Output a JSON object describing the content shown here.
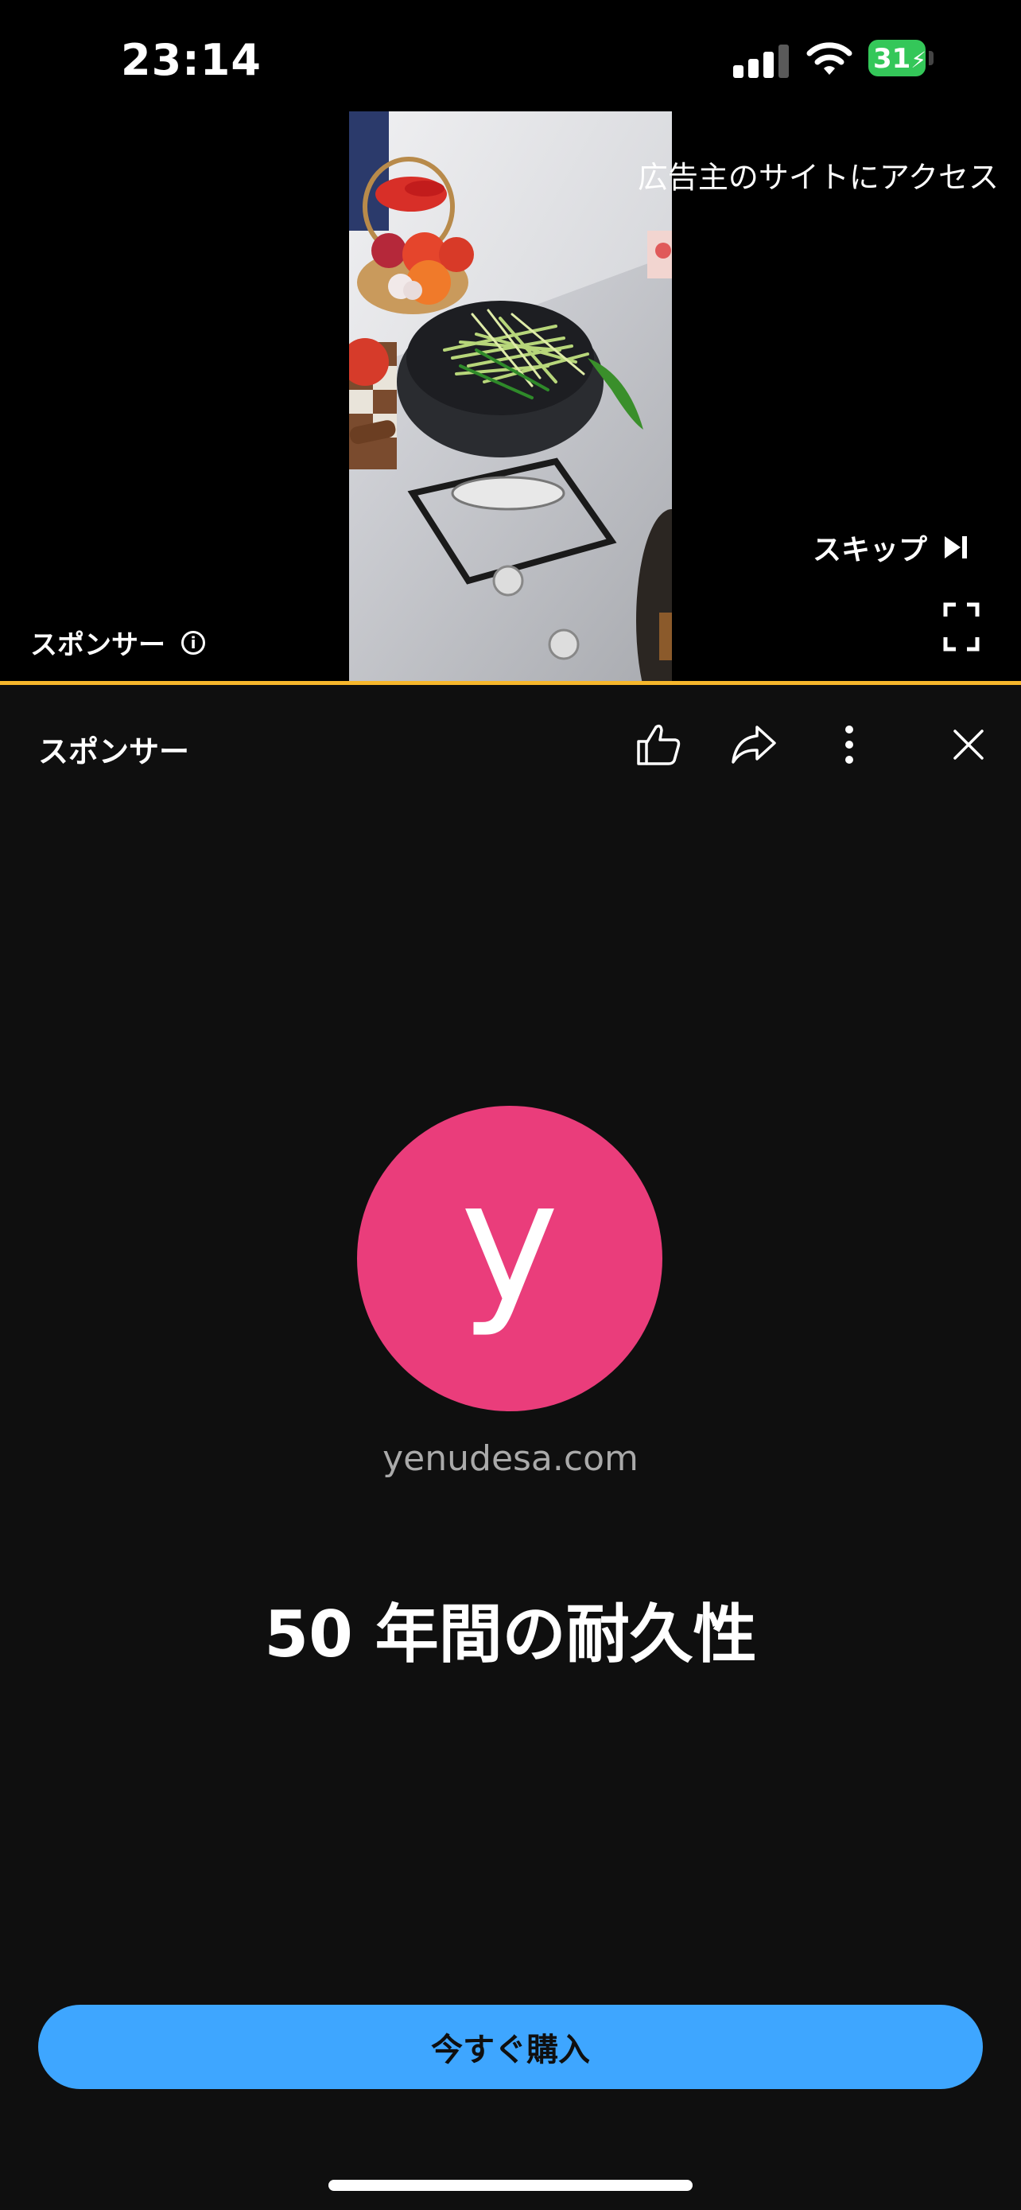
{
  "status_bar": {
    "time": "23:14",
    "battery": "31"
  },
  "player": {
    "visit_advertiser": "広告主のサイトにアクセス",
    "skip_label": "スキップ",
    "sponsor_label": "スポンサー",
    "info_icon": "i",
    "progress_color": "#f6b72c"
  },
  "panel": {
    "title": "スポンサー",
    "icons": [
      "thumbs-up-icon",
      "share-icon",
      "more-vert-icon",
      "close-icon"
    ]
  },
  "advertiser": {
    "avatar_letter": "y",
    "avatar_color": "#ea3d7b",
    "domain": "yenudesa.com"
  },
  "headline": "50 年間の耐久性",
  "cta": {
    "label": "今すぐ購入",
    "color": "#3ea6ff"
  }
}
